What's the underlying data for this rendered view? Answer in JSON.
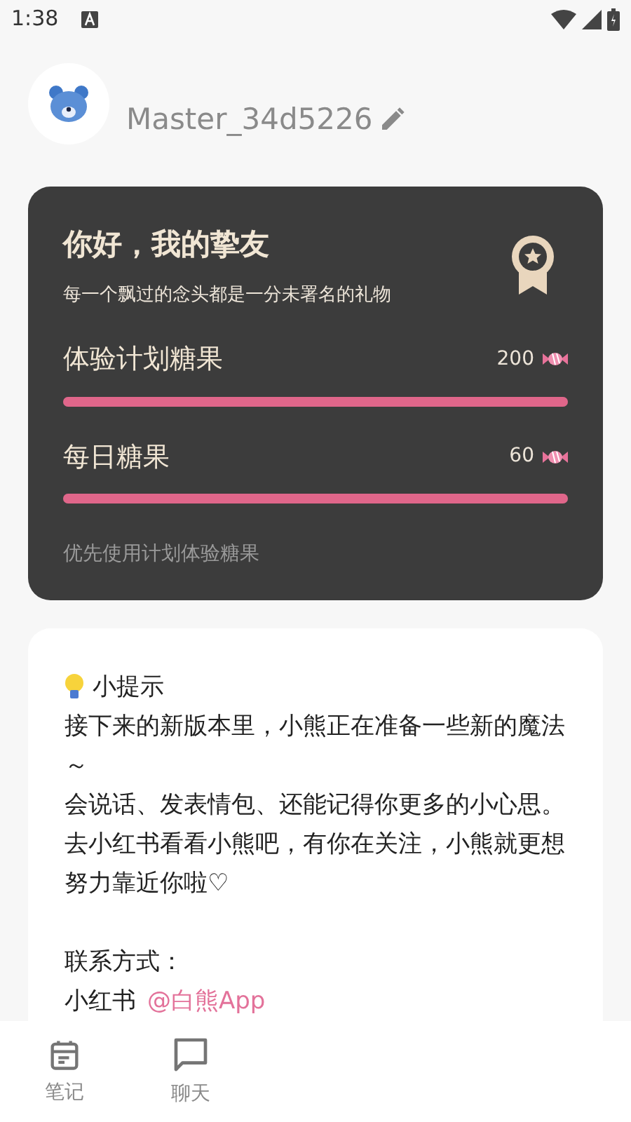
{
  "status_bar": {
    "time": "1:38"
  },
  "profile": {
    "username": "Master_34d5226"
  },
  "candy_card": {
    "title": "你好，我的挚友",
    "subtitle": "每一个飘过的念头都是一分未署名的礼物",
    "meters": [
      {
        "label": "体验计划糖果",
        "reading": "200",
        "level": 1
      },
      {
        "label": "每日糖果",
        "reading": "60",
        "level": 1
      }
    ],
    "note": "优先使用计划体验糖果"
  },
  "tips_card": {
    "heading": "小提示",
    "paragraphs": [
      "接下来的新版本里，小熊正在准备一些新的魔法～",
      "会说话、发表情包、还能记得你更多的小心思。",
      "去小红书看看小熊吧，有你在关注，小熊就更想努力靠近你啦♡"
    ],
    "contact_label": "联系方式：",
    "contact_platform": "小红书",
    "contact_handle": "@白熊App"
  },
  "bottom_nav": [
    {
      "label": "笔记",
      "kind": "notes"
    },
    {
      "label": "聊天",
      "kind": "chat"
    }
  ]
}
